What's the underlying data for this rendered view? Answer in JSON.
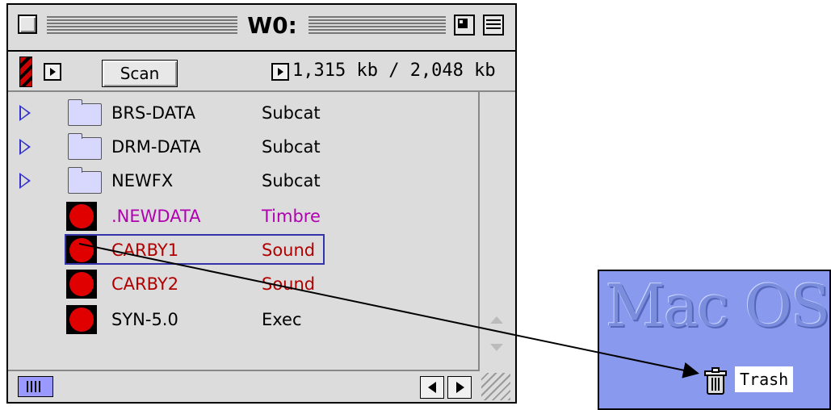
{
  "window": {
    "title": "W0:"
  },
  "toolbar": {
    "scan_label": "Scan",
    "memory": "1,315 kb / 2,048 kb"
  },
  "list": {
    "rows": [
      {
        "name": "BRS-DATA",
        "type": "Subcat",
        "icon": "folder-icon",
        "color": "#000000"
      },
      {
        "name": "DRM-DATA",
        "type": "Subcat",
        "icon": "folder-icon",
        "color": "#000000"
      },
      {
        "name": "NEWFX",
        "type": "Subcat",
        "icon": "folder-icon",
        "color": "#000000"
      },
      {
        "name": ".NEWDATA",
        "type": "Timbre",
        "icon": "red-circle-icon",
        "color": "#b000b0"
      },
      {
        "name": "CARBY1",
        "type": "Sound",
        "icon": "red-circle-icon",
        "color": "#b00000",
        "selected": true
      },
      {
        "name": "CARBY2",
        "type": "Sound",
        "icon": "red-circle-icon",
        "color": "#b00000"
      },
      {
        "name": "SYN-5.0",
        "type": "Exec",
        "icon": "red-circle-icon",
        "color": "#000000"
      }
    ]
  },
  "desktop": {
    "logo_text": "Mac OS",
    "trash_label": "Trash",
    "background": "#8899ee"
  }
}
